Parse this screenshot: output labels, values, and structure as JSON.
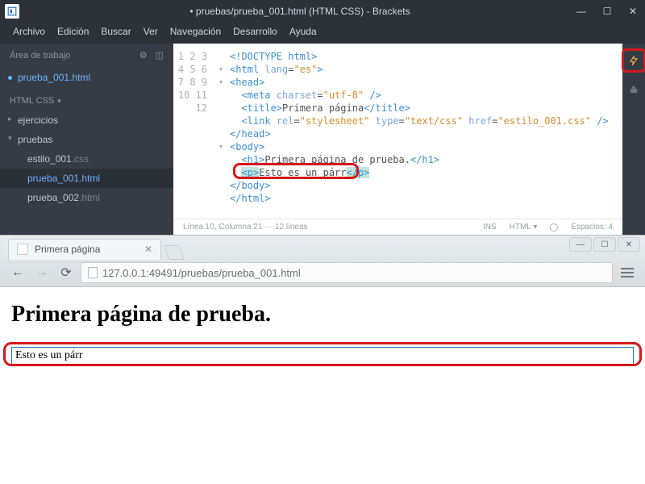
{
  "brackets": {
    "title": "• pruebas/prueba_001.html (HTML CSS) - Brackets",
    "menu": [
      "Archivo",
      "Edición",
      "Buscar",
      "Ver",
      "Navegación",
      "Desarrollo",
      "Ayuda"
    ],
    "sidebar": {
      "workspace_label": "Área de trabajo",
      "open_files": [
        {
          "label": "prueba_001.html"
        }
      ],
      "project_label": "HTML CSS",
      "tree": {
        "folders": [
          {
            "label": "ejercicios",
            "open": false
          },
          {
            "label": "pruebas",
            "open": true,
            "files": [
              {
                "name": "estilo_001",
                "ext": ".css"
              },
              {
                "name": "prueba_001",
                "ext": ".html",
                "selected": true
              },
              {
                "name": "prueba_002",
                "ext": ".html"
              }
            ]
          }
        ]
      }
    },
    "code_lines": [
      "<!DOCTYPE html>",
      "<html lang=\"es\">",
      "<head>",
      "  <meta charset=\"utf-8\" />",
      "  <title>Primera página</title>",
      "  <link rel=\"stylesheet\" type=\"text/css\" href=\"estilo_001.css\" />",
      "</head>",
      "<body>",
      "  <h1>Primera página de prueba.</h1>",
      "  <p>Esto es un párr</p>",
      "</body>",
      "</html>"
    ],
    "status": {
      "pos": "Línea 10, Columna 21",
      "lines": "12 líneas",
      "ins": "INS",
      "lang": "HTML",
      "spaces": "Espacios: 4"
    }
  },
  "browser": {
    "tab_title": "Primera página",
    "url": "127.0.0.1:49491/pruebas/prueba_001.html",
    "h1": "Primera página de prueba.",
    "para": "Esto es un párr"
  }
}
